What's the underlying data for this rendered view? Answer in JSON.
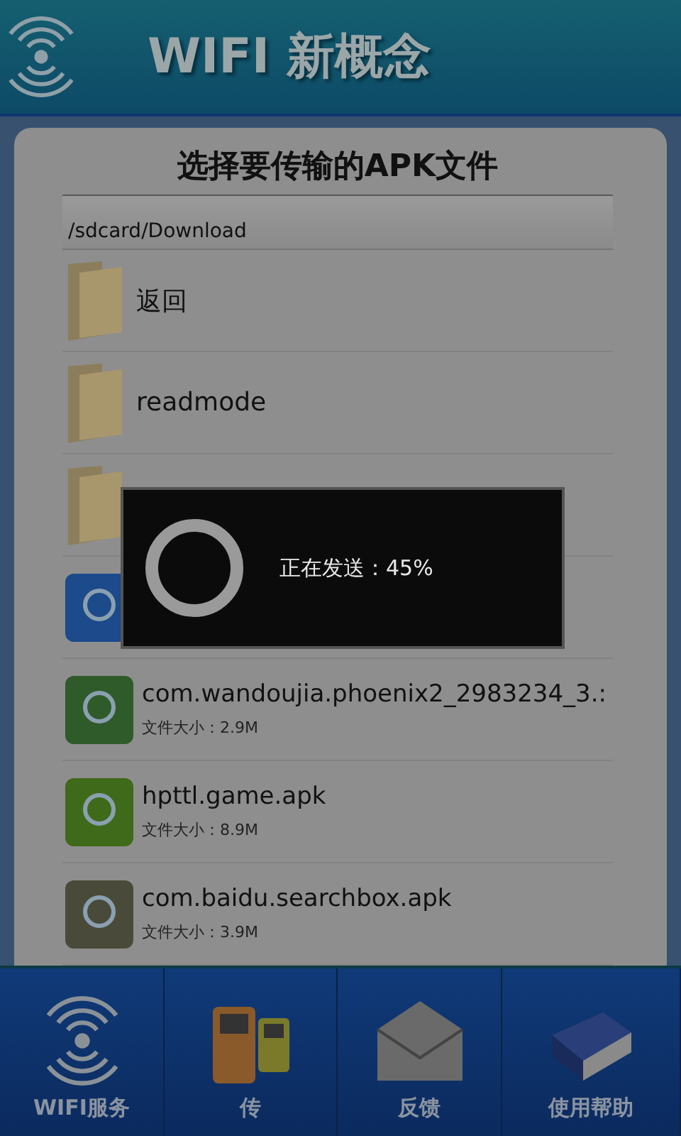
{
  "header": {
    "title": "WIFI 新概念"
  },
  "panel": {
    "title": "选择要传输的APK文件",
    "path": "/sdcard/Download",
    "files": [
      {
        "kind": "folder",
        "name": "返回"
      },
      {
        "kind": "folder",
        "name": "readmode"
      },
      {
        "kind": "folder"
      },
      {
        "kind": "apk"
      },
      {
        "kind": "apk",
        "name": "com.wandoujia.phoenix2_2983234_3.:",
        "size": "文件大小：2.9M"
      },
      {
        "kind": "apk",
        "name": "hpttl.game.apk",
        "size": "文件大小：8.9M"
      },
      {
        "kind": "apk",
        "name": "com.baidu.searchbox.apk",
        "size": "文件大小：3.9M"
      }
    ]
  },
  "dialog": {
    "message": "正在发送：45%"
  },
  "tabs": [
    {
      "label": "WIFI服务"
    },
    {
      "label": "传"
    },
    {
      "label": "反馈"
    },
    {
      "label": "使用帮助"
    }
  ]
}
